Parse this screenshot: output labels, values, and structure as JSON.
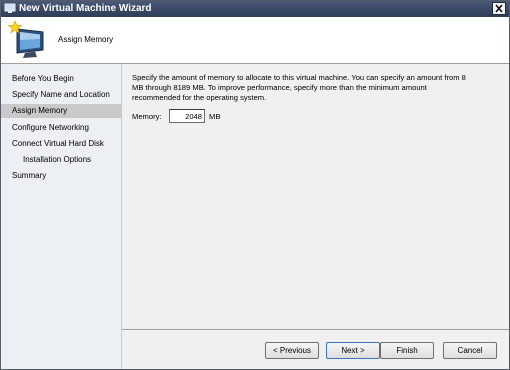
{
  "window": {
    "title": "New Virtual Machine Wizard",
    "close_glyph": "✕"
  },
  "header": {
    "page_title": "Assign Memory",
    "icon": "monitor-star-icon"
  },
  "nav": {
    "items": [
      {
        "label": "Before You Begin",
        "selected": false,
        "indent": false
      },
      {
        "label": "Specify Name and Location",
        "selected": false,
        "indent": false
      },
      {
        "label": "Assign Memory",
        "selected": true,
        "indent": false
      },
      {
        "label": "Configure Networking",
        "selected": false,
        "indent": false
      },
      {
        "label": "Connect Virtual Hard Disk",
        "selected": false,
        "indent": false
      },
      {
        "label": "Installation Options",
        "selected": false,
        "indent": true
      },
      {
        "label": "Summary",
        "selected": false,
        "indent": false
      }
    ]
  },
  "content": {
    "description": "Specify the amount of memory to allocate to this virtual machine. You can specify an amount from 8 MB through 8189 MB. To improve performance, specify more than the minimum amount recommended for the operating system.",
    "memory_label": "Memory:",
    "memory_value": "2048",
    "memory_unit": "MB"
  },
  "footer": {
    "previous_label": "< Previous",
    "next_label": "Next >",
    "finish_label": "Finish",
    "cancel_label": "Cancel"
  }
}
